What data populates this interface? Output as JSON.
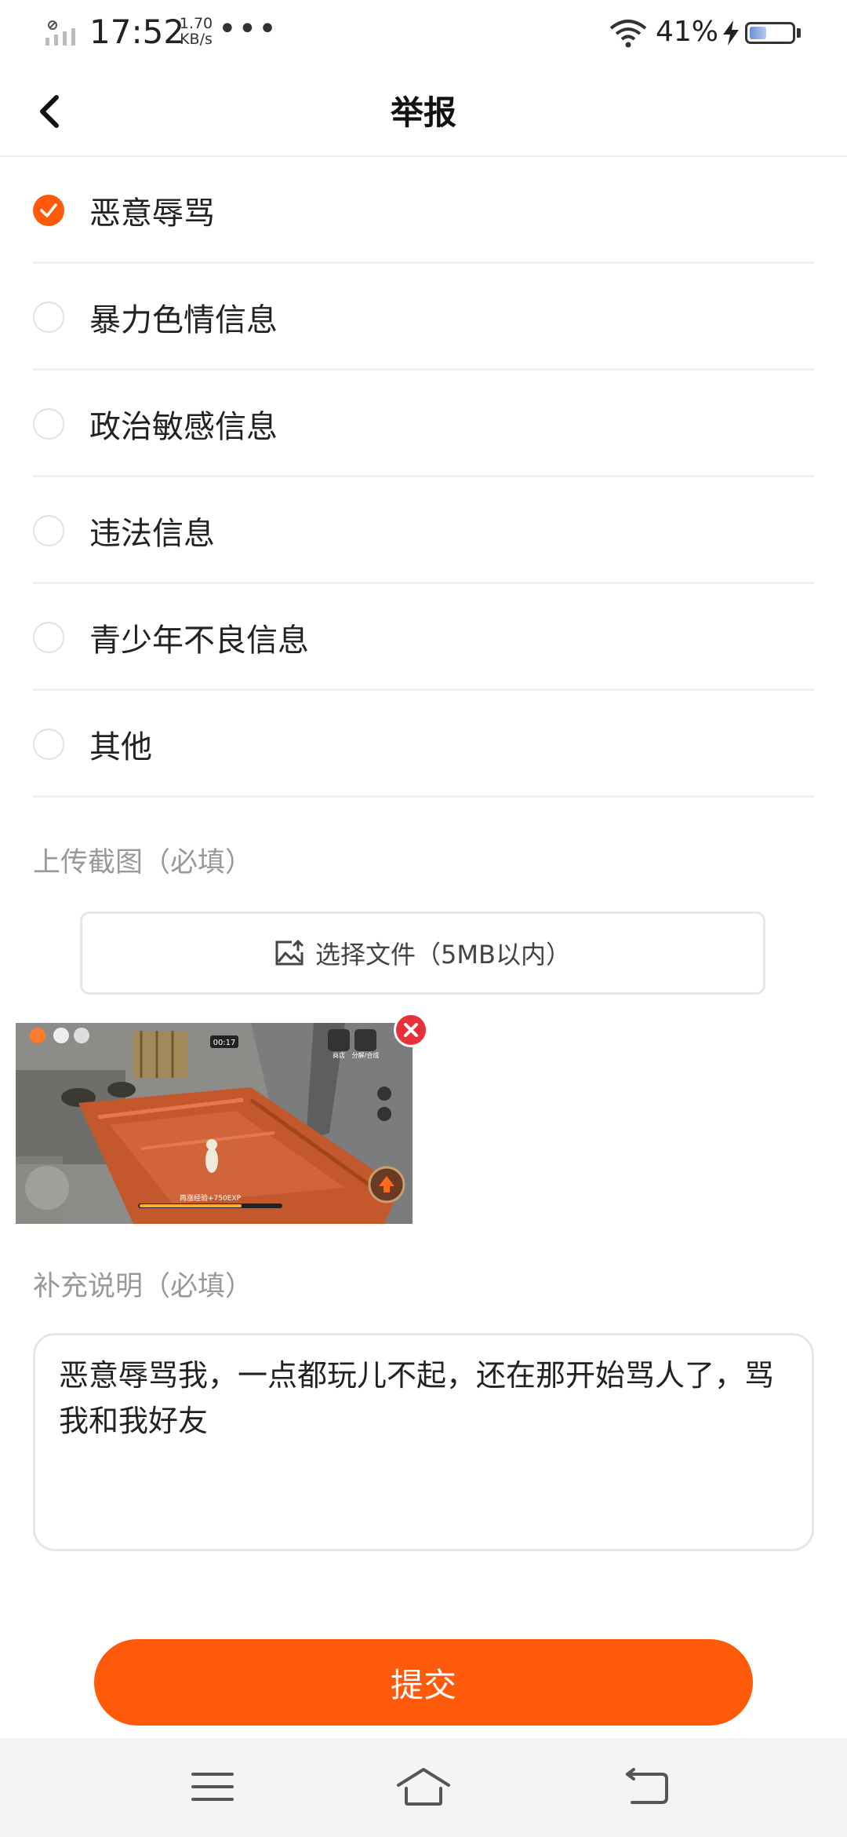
{
  "status_bar": {
    "time": "17:52",
    "net_speed_value": "1.70",
    "net_speed_unit": "KB/s",
    "more": "•••",
    "battery_percent": "41%",
    "battery_level": 0.41
  },
  "header": {
    "title": "举报"
  },
  "report_options": [
    {
      "label": "恶意辱骂",
      "checked": true
    },
    {
      "label": "暴力色情信息",
      "checked": false
    },
    {
      "label": "政治敏感信息",
      "checked": false
    },
    {
      "label": "违法信息",
      "checked": false
    },
    {
      "label": "青少年不良信息",
      "checked": false
    },
    {
      "label": "其他",
      "checked": false
    }
  ],
  "upload": {
    "section_label": "上传截图（必填）",
    "button_label": "选择文件（5MB以内）"
  },
  "thumbnail_overlay": {
    "timer": "00:17",
    "progress_text": "再涨经验+750EXP",
    "button_labels": [
      "商店",
      "分解/合成"
    ]
  },
  "description": {
    "section_label": "补充说明（必填）",
    "value": "恶意辱骂我，一点都玩儿不起，还在那开始骂人了，骂我和我好友"
  },
  "submit_label": "提交",
  "colors": {
    "accent": "#ff5a0a",
    "remove_badge": "#e8303a"
  }
}
